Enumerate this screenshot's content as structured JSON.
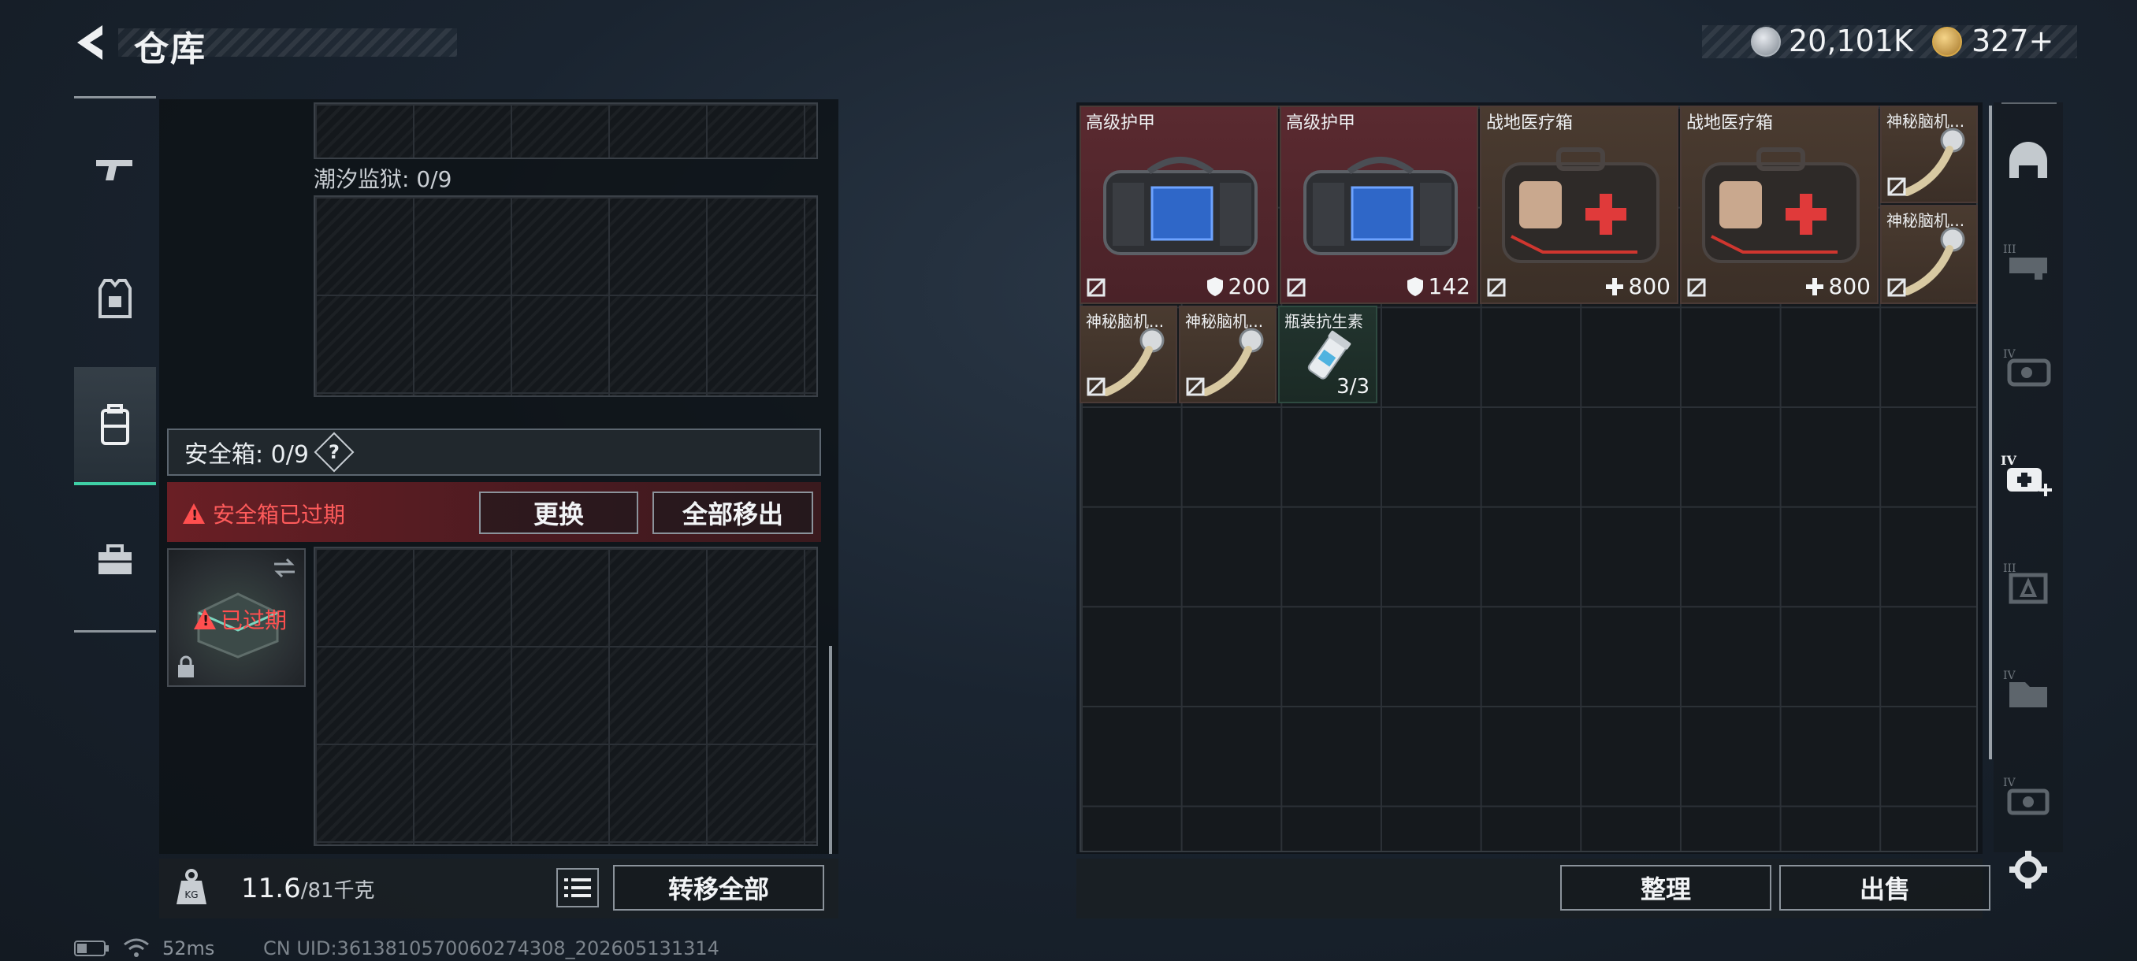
{
  "header": {
    "title": "仓库",
    "currency": [
      {
        "icon": "silver-coin-icon",
        "value": "20,101K"
      },
      {
        "icon": "gold-coin-icon",
        "value": "327+"
      }
    ]
  },
  "left_nav": {
    "items": [
      {
        "icon": "gun-icon",
        "active": false
      },
      {
        "icon": "armor-vest-icon",
        "active": false
      },
      {
        "icon": "backpack-icon",
        "active": true
      },
      {
        "icon": "toolbox-icon",
        "active": false
      }
    ]
  },
  "left_panel": {
    "tide_prison_label": "潮汐监狱: 0/9",
    "safe_box_label": "安全箱:  0/9",
    "help_label": "?",
    "expired_notice": "安全箱已过期",
    "replace_button": "更换",
    "move_all_out_button": "全部移出",
    "safe_item_expired": "已过期",
    "weight_value": "11.6",
    "weight_capacity": "/81千克",
    "transfer_all_button": "转移全部"
  },
  "inventory": {
    "items": [
      {
        "name": "高级护甲",
        "stat": "200",
        "stat_icon": "shield-icon",
        "rarity": "red",
        "image": "armor"
      },
      {
        "name": "高级护甲",
        "stat": "142",
        "stat_icon": "shield-icon",
        "rarity": "red",
        "image": "armor"
      },
      {
        "name": "战地医疗箱",
        "stat": "800",
        "stat_icon": "plus-icon",
        "rarity": "brown",
        "image": "medkit"
      },
      {
        "name": "战地医疗箱",
        "stat": "800",
        "stat_icon": "plus-icon",
        "rarity": "brown",
        "image": "medkit"
      },
      {
        "name": "神秘脑机...",
        "stat": "",
        "stat_icon": "",
        "rarity": "brown",
        "image": "chip"
      },
      {
        "name": "神秘脑机...",
        "stat": "",
        "stat_icon": "",
        "rarity": "brown",
        "image": "chip"
      },
      {
        "name": "神秘脑机...",
        "stat": "",
        "stat_icon": "",
        "rarity": "brown",
        "image": "chip"
      },
      {
        "name": "神秘脑机...",
        "stat": "",
        "stat_icon": "",
        "rarity": "brown",
        "image": "chip"
      },
      {
        "name": "瓶装抗生素",
        "stat": "3/3",
        "stat_icon": "",
        "rarity": "green",
        "image": "pills"
      }
    ],
    "sort_button": "整理",
    "sell_button": "出售"
  },
  "filters": [
    {
      "icon": "helmet-filter-icon",
      "active": false
    },
    {
      "icon": "tier3-weapon-filter-icon",
      "active": false
    },
    {
      "icon": "tier4-armor-filter-icon",
      "active": false
    },
    {
      "icon": "tier4-medical-filter-icon",
      "active": true
    },
    {
      "icon": "tier3-ammo-filter-icon",
      "active": false
    },
    {
      "icon": "tier4-document-filter-icon",
      "active": false
    },
    {
      "icon": "tier4-misc-filter-icon",
      "active": false
    }
  ],
  "status": {
    "ping": "52ms",
    "uid": "CN UID:3613810570060274308_202605131314"
  }
}
